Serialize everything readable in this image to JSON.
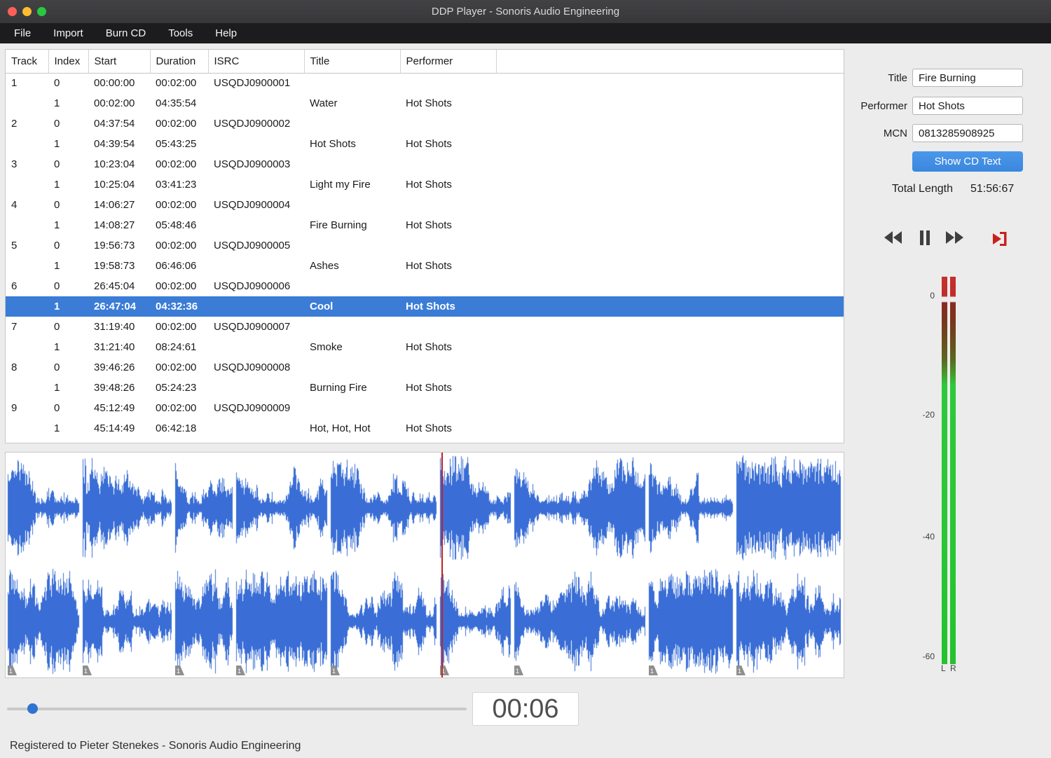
{
  "window": {
    "title": "DDP Player - Sonoris Audio Engineering",
    "status_text": "Registered to Pieter Stenekes - Sonoris Audio Engineering"
  },
  "menu": {
    "items": [
      "File",
      "Import",
      "Burn CD",
      "Tools",
      "Help"
    ]
  },
  "table": {
    "columns": [
      "Track",
      "Index",
      "Start",
      "Duration",
      "ISRC",
      "Title",
      "Performer"
    ],
    "rows": [
      {
        "track": "1",
        "index": "0",
        "start": "00:00:00",
        "duration": "00:02:00",
        "isrc": "USQDJ0900001",
        "title": "",
        "performer": "",
        "selected": false
      },
      {
        "track": "",
        "index": "1",
        "start": "00:02:00",
        "duration": "04:35:54",
        "isrc": "",
        "title": "Water",
        "performer": "Hot Shots",
        "selected": false
      },
      {
        "track": "2",
        "index": "0",
        "start": "04:37:54",
        "duration": "00:02:00",
        "isrc": "USQDJ0900002",
        "title": "",
        "performer": "",
        "selected": false
      },
      {
        "track": "",
        "index": "1",
        "start": "04:39:54",
        "duration": "05:43:25",
        "isrc": "",
        "title": "Hot Shots",
        "performer": "Hot Shots",
        "selected": false
      },
      {
        "track": "3",
        "index": "0",
        "start": "10:23:04",
        "duration": "00:02:00",
        "isrc": "USQDJ0900003",
        "title": "",
        "performer": "",
        "selected": false
      },
      {
        "track": "",
        "index": "1",
        "start": "10:25:04",
        "duration": "03:41:23",
        "isrc": "",
        "title": "Light my Fire",
        "performer": "Hot Shots",
        "selected": false
      },
      {
        "track": "4",
        "index": "0",
        "start": "14:06:27",
        "duration": "00:02:00",
        "isrc": "USQDJ0900004",
        "title": "",
        "performer": "",
        "selected": false
      },
      {
        "track": "",
        "index": "1",
        "start": "14:08:27",
        "duration": "05:48:46",
        "isrc": "",
        "title": "Fire Burning",
        "performer": "Hot Shots",
        "selected": false
      },
      {
        "track": "5",
        "index": "0",
        "start": "19:56:73",
        "duration": "00:02:00",
        "isrc": "USQDJ0900005",
        "title": "",
        "performer": "",
        "selected": false
      },
      {
        "track": "",
        "index": "1",
        "start": "19:58:73",
        "duration": "06:46:06",
        "isrc": "",
        "title": "Ashes",
        "performer": "Hot Shots",
        "selected": false
      },
      {
        "track": "6",
        "index": "0",
        "start": "26:45:04",
        "duration": "00:02:00",
        "isrc": "USQDJ0900006",
        "title": "",
        "performer": "",
        "selected": false
      },
      {
        "track": "",
        "index": "1",
        "start": "26:47:04",
        "duration": "04:32:36",
        "isrc": "",
        "title": "Cool",
        "performer": "Hot Shots",
        "selected": true
      },
      {
        "track": "7",
        "index": "0",
        "start": "31:19:40",
        "duration": "00:02:00",
        "isrc": "USQDJ0900007",
        "title": "",
        "performer": "",
        "selected": false
      },
      {
        "track": "",
        "index": "1",
        "start": "31:21:40",
        "duration": "08:24:61",
        "isrc": "",
        "title": "Smoke",
        "performer": "Hot Shots",
        "selected": false
      },
      {
        "track": "8",
        "index": "0",
        "start": "39:46:26",
        "duration": "00:02:00",
        "isrc": "USQDJ0900008",
        "title": "",
        "performer": "",
        "selected": false
      },
      {
        "track": "",
        "index": "1",
        "start": "39:48:26",
        "duration": "05:24:23",
        "isrc": "",
        "title": "Burning Fire",
        "performer": "Hot Shots",
        "selected": false
      },
      {
        "track": "9",
        "index": "0",
        "start": "45:12:49",
        "duration": "00:02:00",
        "isrc": "USQDJ0900009",
        "title": "",
        "performer": "",
        "selected": false
      },
      {
        "track": "",
        "index": "1",
        "start": "45:14:49",
        "duration": "06:42:18",
        "isrc": "",
        "title": "Hot, Hot, Hot",
        "performer": "Hot Shots",
        "selected": false
      }
    ]
  },
  "cd_text": {
    "title_label": "Title",
    "title_value": "Fire Burning",
    "performer_label": "Performer",
    "performer_value": "Hot Shots",
    "mcn_label": "MCN",
    "mcn_value": "0813285908925",
    "show_cd_text_button": "Show CD Text",
    "total_length_label": "Total Length",
    "total_length_value": "51:56:67"
  },
  "transport": {
    "time_display": "00:06",
    "slider_fraction": 0.045
  },
  "meter": {
    "ticks": [
      "0",
      "-20",
      "-40",
      "-60"
    ],
    "channel_labels": [
      "L",
      "R"
    ]
  },
  "waveform": {
    "color": "#3a6ed6",
    "playhead_color": "#c32222",
    "playhead_fraction": 0.52,
    "index_marker_label": "1",
    "segment_seconds": [
      276,
      343,
      221,
      349,
      406,
      273,
      505,
      324,
      402
    ]
  }
}
